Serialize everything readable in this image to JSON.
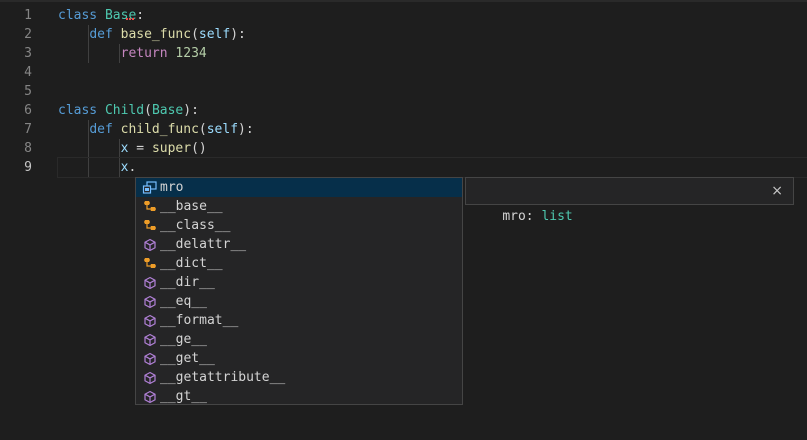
{
  "editor": {
    "line_numbers": [
      "1",
      "2",
      "3",
      "4",
      "5",
      "6",
      "7",
      "8",
      "9"
    ],
    "lines": [
      {
        "tokens": [
          [
            "kw",
            "class"
          ],
          [
            "plain",
            " "
          ],
          [
            "cls",
            "Base"
          ],
          [
            "plain",
            ":"
          ]
        ]
      },
      {
        "tokens": [
          [
            "plain",
            "    "
          ],
          [
            "kw",
            "def"
          ],
          [
            "plain",
            " "
          ],
          [
            "fn",
            "base_func"
          ],
          [
            "plain",
            "("
          ],
          [
            "var",
            "self"
          ],
          [
            "plain",
            "):"
          ]
        ]
      },
      {
        "tokens": [
          [
            "plain",
            "        "
          ],
          [
            "ctl",
            "return"
          ],
          [
            "plain",
            " "
          ],
          [
            "num",
            "1234"
          ]
        ]
      },
      {
        "tokens": []
      },
      {
        "tokens": []
      },
      {
        "tokens": [
          [
            "kw",
            "class"
          ],
          [
            "plain",
            " "
          ],
          [
            "cls",
            "Child"
          ],
          [
            "plain",
            "("
          ],
          [
            "cls",
            "Base"
          ],
          [
            "plain",
            "):"
          ]
        ]
      },
      {
        "tokens": [
          [
            "plain",
            "    "
          ],
          [
            "kw",
            "def"
          ],
          [
            "plain",
            " "
          ],
          [
            "fn",
            "child_func"
          ],
          [
            "plain",
            "("
          ],
          [
            "var",
            "self"
          ],
          [
            "plain",
            "):"
          ]
        ]
      },
      {
        "tokens": [
          [
            "plain",
            "        "
          ],
          [
            "var",
            "x"
          ],
          [
            "plain",
            " = "
          ],
          [
            "fn",
            "super"
          ],
          [
            "plain",
            "()"
          ]
        ]
      },
      {
        "tokens": [
          [
            "plain",
            "        "
          ],
          [
            "var",
            "x"
          ],
          [
            "plain",
            "."
          ]
        ]
      }
    ],
    "active_line": "9"
  },
  "suggest": {
    "items": [
      {
        "label": "mro",
        "icon": "field-icon",
        "selected": true
      },
      {
        "label": "__base__",
        "icon": "class-icon"
      },
      {
        "label": "__class__",
        "icon": "class-icon"
      },
      {
        "label": "__delattr__",
        "icon": "method-icon"
      },
      {
        "label": "__dict__",
        "icon": "class-icon"
      },
      {
        "label": "__dir__",
        "icon": "method-icon"
      },
      {
        "label": "__eq__",
        "icon": "method-icon"
      },
      {
        "label": "__format__",
        "icon": "method-icon"
      },
      {
        "label": "__ge__",
        "icon": "method-icon"
      },
      {
        "label": "__get__",
        "icon": "method-icon"
      },
      {
        "label": "__getattribute__",
        "icon": "method-icon"
      },
      {
        "label": "__gt__",
        "icon": "method-icon"
      }
    ]
  },
  "details": {
    "name": "mro:",
    "type": "list",
    "close_glyph": "×"
  },
  "colors": {
    "background": "#1e1e1e",
    "keyword": "#569cd6",
    "class": "#4ec9b0",
    "function": "#dcdcaa",
    "control": "#c586c0",
    "number": "#b5cea8",
    "variable": "#9cdcfe",
    "selection": "#062f4a"
  }
}
